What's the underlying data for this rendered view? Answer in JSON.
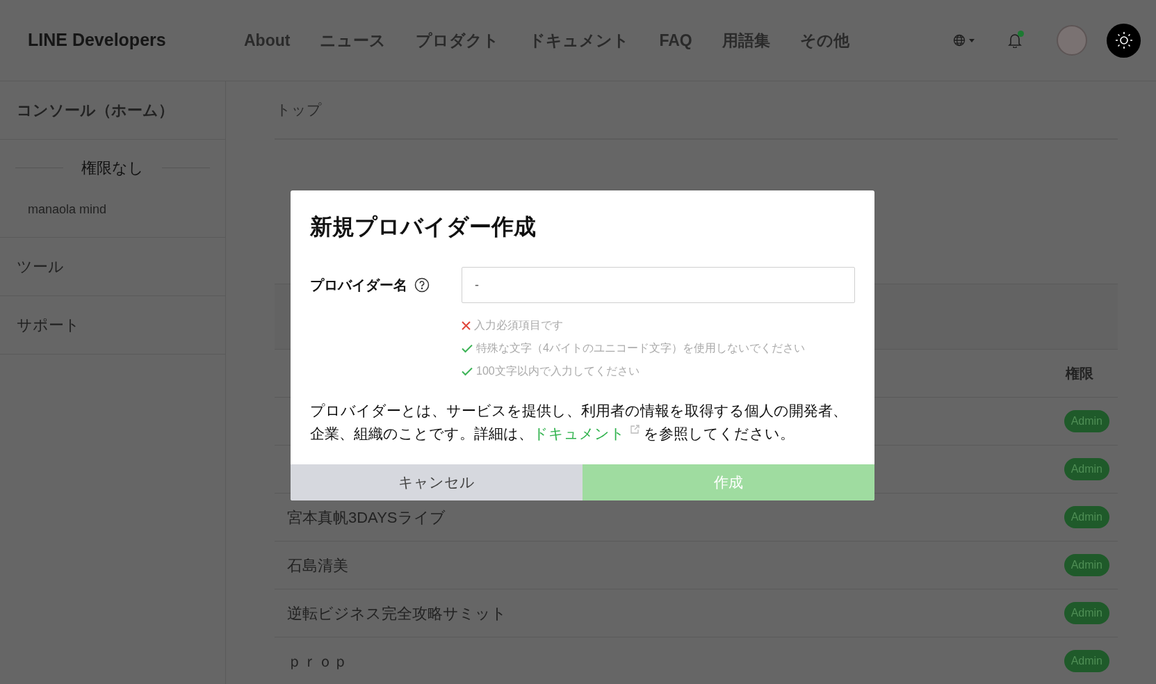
{
  "header": {
    "logo": "LINE Developers",
    "nav": [
      "About",
      "ニュース",
      "プロダクト",
      "ドキュメント",
      "FAQ",
      "用語集",
      "その他"
    ],
    "has_notification": true
  },
  "sidebar": {
    "home": "コンソール（ホーム）",
    "section": "権限なし",
    "providers": [
      "manaola mind"
    ],
    "items": [
      "ツール",
      "サポート"
    ]
  },
  "breadcrumb": "トップ",
  "table": {
    "permission_header": "権限",
    "rows": [
      {
        "role": "Admin"
      },
      {
        "role": "Admin"
      },
      {
        "name": "宮本真帆3DAYSライブ",
        "role": "Admin"
      },
      {
        "name": "石島清美",
        "role": "Admin"
      },
      {
        "name": "逆転ビジネス完全攻略サミット",
        "role": "Admin"
      },
      {
        "name": "ｐｒｏｐ",
        "role": "Admin"
      }
    ]
  },
  "dialog": {
    "title": "新規プロバイダー作成",
    "field_label": "プロバイダー名",
    "field_value": "-",
    "rules": [
      {
        "text": "入力必須項目です",
        "valid": false
      },
      {
        "text": "特殊な文字（4バイトのユニコード文字）を使用しないでください",
        "valid": true
      },
      {
        "text": "100文字以内で入力してください",
        "valid": true
      }
    ],
    "description_before": "プロバイダーとは、サービスを提供し、利用者の情報を取得する個人の開発者、企業、組織のことです。詳細は、",
    "description_link": "ドキュメント",
    "description_after": "を参照してください。",
    "cancel": "キャンセル",
    "create": {
      "label": "作成",
      "disabled": true
    }
  }
}
